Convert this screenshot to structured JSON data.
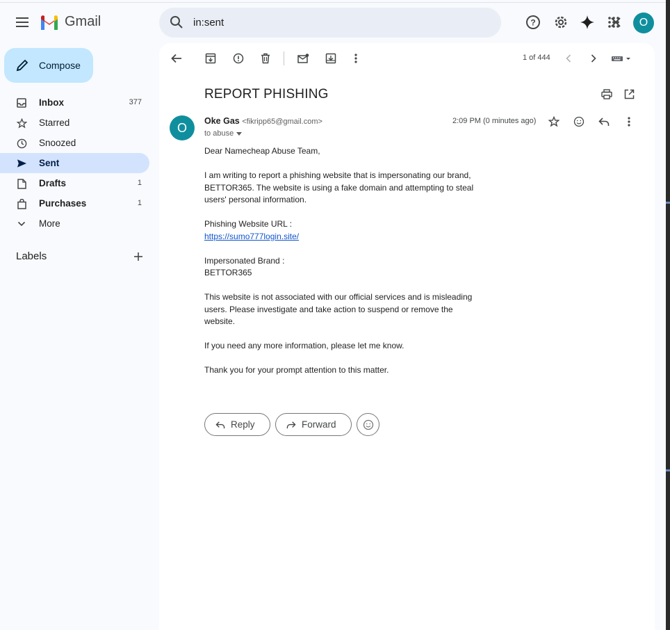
{
  "app": {
    "name": "Gmail"
  },
  "search": {
    "value": "in:sent"
  },
  "header": {
    "account_initial": "O"
  },
  "compose": {
    "label": "Compose"
  },
  "sidebar": {
    "items": [
      {
        "label": "Inbox",
        "count": "377",
        "icon": "inbox-icon"
      },
      {
        "label": "Starred",
        "count": "",
        "icon": "star-icon"
      },
      {
        "label": "Snoozed",
        "count": "",
        "icon": "clock-icon"
      },
      {
        "label": "Sent",
        "count": "",
        "icon": "send-icon"
      },
      {
        "label": "Drafts",
        "count": "1",
        "icon": "draft-icon"
      },
      {
        "label": "Purchases",
        "count": "1",
        "icon": "bag-icon"
      },
      {
        "label": "More",
        "count": "",
        "icon": "chevron-down-icon"
      }
    ],
    "labels_heading": "Labels"
  },
  "toolbar": {
    "pager": "1 of 444"
  },
  "email": {
    "subject": "REPORT PHISHING",
    "sender_name": "Oke Gas",
    "sender_email": "<fikripp65@gmail.com>",
    "sender_initial": "O",
    "to": "to abuse",
    "time": "2:09 PM (0 minutes ago)",
    "greeting": "Dear Namecheap Abuse Team,",
    "p1": "I am writing to report a phishing website that is impersonating our brand, BETTOR365. The website is using a fake domain and attempting to steal users' personal information.",
    "url_label": "Phishing Website URL :",
    "url": "https://sumo777login.site/",
    "brand_label": "Impersonated Brand :",
    "brand": "BETTOR365",
    "p2": "This website is not associated with our official services and is misleading users. Please investigate and take action to suspend or remove the website.",
    "p3": "If you need any more information, please let me know.",
    "p4": "Thank you for your prompt attention to this matter."
  },
  "actions": {
    "reply": "Reply",
    "forward": "Forward"
  },
  "colors": {
    "accent": "#c2e7ff",
    "active_nav": "#d3e3fd",
    "avatar": "#0f8f9e",
    "link": "#1155cc"
  }
}
